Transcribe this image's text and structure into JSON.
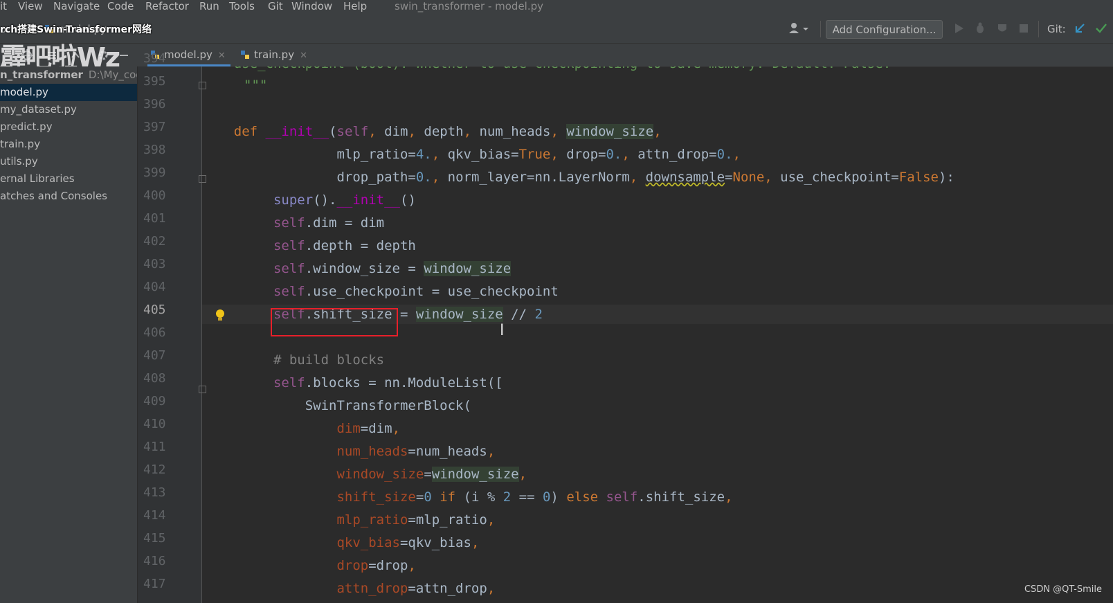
{
  "menu": {
    "items": [
      "it",
      "View",
      "Navigate",
      "Code",
      "Refactor",
      "Run",
      "Tools",
      "Git",
      "Window",
      "Help"
    ],
    "window_title": "swin_transformer - model.py"
  },
  "toolbar": {
    "breadcrumb_project": "ormer",
    "breadcrumb_file": "model.py",
    "add_configuration": "Add Configuration...",
    "git_label": "Git:"
  },
  "watermark": {
    "title": "rch搭建Swin-Transformer网络",
    "text": "霹吧啦Wz bilibili"
  },
  "tabs": [
    {
      "label": "model.py",
      "active": true
    },
    {
      "label": "train.py",
      "active": false
    }
  ],
  "sidebar": {
    "project_name": "n_transformer",
    "project_path": "D:\\My_code",
    "items": [
      "model.py",
      "my_dataset.py",
      "predict.py",
      "train.py",
      "utils.py",
      "ernal Libraries",
      "atches and Consoles"
    ]
  },
  "editor": {
    "line_numbers": [
      "394",
      "395",
      "396",
      "397",
      "398",
      "399",
      "400",
      "401",
      "402",
      "403",
      "404",
      "405",
      "406",
      "407",
      "408",
      "409",
      "410",
      "411",
      "412",
      "413",
      "414",
      "415",
      "416",
      "417"
    ],
    "current_line": "405",
    "partial_top_line": "    use_checkpoint (bool): Whether to use checkpointing to save memory. Default: False.",
    "docstring_close": "\"\"\"",
    "comment_build_blocks": "# build blocks"
  },
  "footer": {
    "credit": "CSDN @QT-Smile"
  }
}
